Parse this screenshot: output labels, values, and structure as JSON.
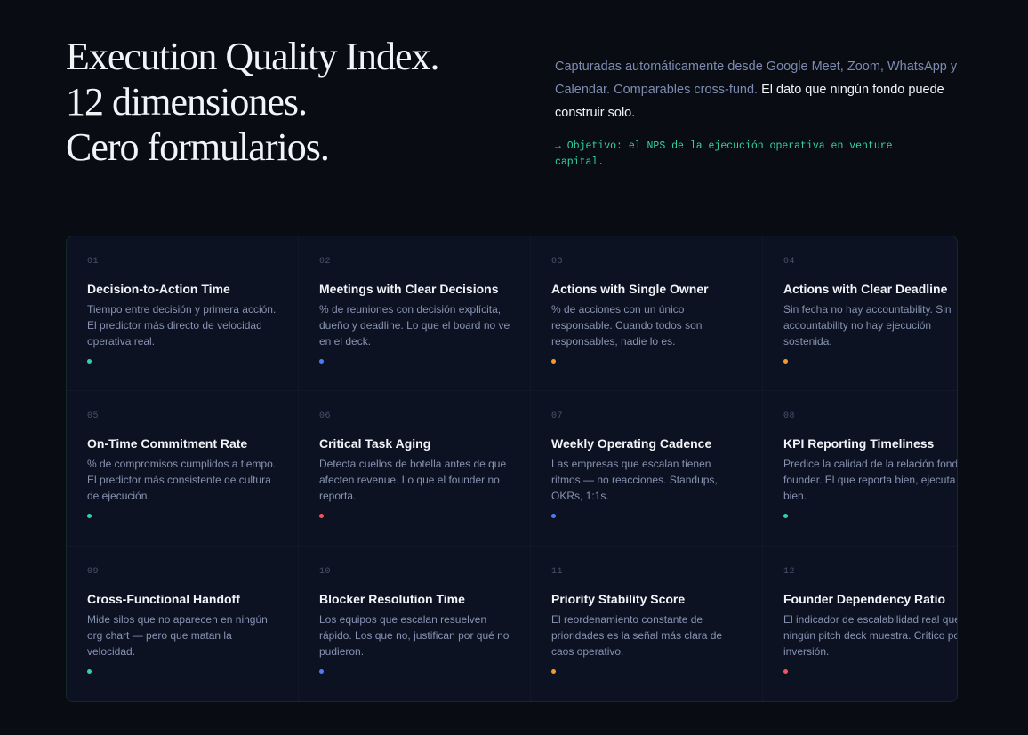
{
  "hero": {
    "title_lines": [
      "Execution Quality Index.",
      "12 dimensiones.",
      "Cero formularios."
    ],
    "description": "Capturadas automáticamente desde Google Meet, Zoom, WhatsApp y Calendar. Comparables cross-fund.",
    "description_emphasis": "El dato que ningún fondo puede construir solo.",
    "note": "→ Objetivo: el NPS de la ejecución operativa en venture capital."
  },
  "colors": {
    "teal": "#2fd3a6",
    "blue": "#4f7cf5",
    "orange": "#f29a2e",
    "red": "#f0545c"
  },
  "metrics": [
    {
      "num": "01",
      "title": "Decision-to-Action Time",
      "desc": "Tiempo entre decisión y primera acción. El predictor más directo de velocidad operativa real.",
      "dot": "teal"
    },
    {
      "num": "02",
      "title": "Meetings with Clear Decisions",
      "desc": "% de reuniones con decisión explícita, dueño y deadline. Lo que el board no ve en el deck.",
      "dot": "blue"
    },
    {
      "num": "03",
      "title": "Actions with Single Owner",
      "desc": "% de acciones con un único responsable. Cuando todos son responsables, nadie lo es.",
      "dot": "orange"
    },
    {
      "num": "04",
      "title": "Actions with Clear Deadline",
      "desc": "Sin fecha no hay accountability. Sin accountability no hay ejecución sostenida.",
      "dot": "orange"
    },
    {
      "num": "05",
      "title": "On-Time Commitment Rate",
      "desc": "% de compromisos cumplidos a tiempo. El predictor más consistente de cultura de ejecución.",
      "dot": "teal"
    },
    {
      "num": "06",
      "title": "Critical Task Aging",
      "desc": "Detecta cuellos de botella antes de que afecten revenue. Lo que el founder no reporta.",
      "dot": "red"
    },
    {
      "num": "07",
      "title": "Weekly Operating Cadence",
      "desc": "Las empresas que escalan tienen ritmos — no reacciones. Standups, OKRs, 1:1s.",
      "dot": "blue"
    },
    {
      "num": "08",
      "title": "KPI Reporting Timeliness",
      "desc": "Predice la calidad de la relación fondo-founder. El que reporta bien, ejecuta bien.",
      "dot": "teal"
    },
    {
      "num": "09",
      "title": "Cross-Functional Handoff",
      "desc": "Mide silos que no aparecen en ningún org chart — pero que matan la velocidad.",
      "dot": "teal"
    },
    {
      "num": "10",
      "title": "Blocker Resolution Time",
      "desc": "Los equipos que escalan resuelven rápido. Los que no, justifican por qué no pudieron.",
      "dot": "blue"
    },
    {
      "num": "11",
      "title": "Priority Stability Score",
      "desc": "El reordenamiento constante de prioridades es la señal más clara de caos operativo.",
      "dot": "orange"
    },
    {
      "num": "12",
      "title": "Founder Dependency Ratio",
      "desc": "El indicador de escalabilidad real que ningún pitch deck muestra. Crítico post-inversión.",
      "dot": "red"
    }
  ]
}
